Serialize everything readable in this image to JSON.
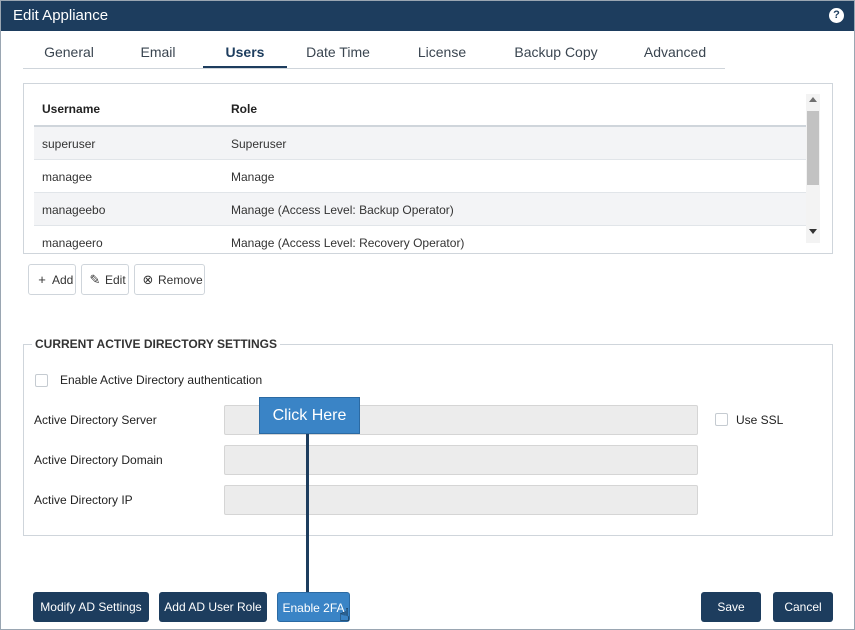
{
  "window": {
    "title": "Edit Appliance",
    "help_icon": "?"
  },
  "tabs": [
    "General",
    "Email",
    "Users",
    "Date Time",
    "License",
    "Backup Copy",
    "Advanced"
  ],
  "active_tab": "Users",
  "users_table": {
    "columns": [
      "Username",
      "Role"
    ],
    "rows": [
      {
        "username": "superuser",
        "role": "Superuser"
      },
      {
        "username": "managee",
        "role": "Manage"
      },
      {
        "username": "manageebo",
        "role": "Manage (Access Level: Backup Operator)"
      },
      {
        "username": "manageero",
        "role": "Manage (Access Level: Recovery Operator)"
      }
    ]
  },
  "table_actions": {
    "add": {
      "label": "Add",
      "icon": "plus-icon",
      "glyph": "+"
    },
    "edit": {
      "label": "Edit",
      "icon": "edit-icon",
      "glyph": "✎"
    },
    "remove": {
      "label": "Remove",
      "icon": "remove-circle-icon",
      "glyph": "⊗"
    }
  },
  "ad_settings": {
    "legend": "CURRENT ACTIVE DIRECTORY SETTINGS",
    "enable_label": "Enable Active Directory authentication",
    "enable_checked": false,
    "server_label": "Active Directory Server",
    "server_value": "",
    "use_ssl_label": "Use SSL",
    "use_ssl_checked": false,
    "domain_label": "Active Directory Domain",
    "domain_value": "",
    "ip_label": "Active Directory IP",
    "ip_value": ""
  },
  "footer": {
    "modify_ad": "Modify AD Settings",
    "add_ad_role": "Add AD User Role",
    "enable_2fa": "Enable 2FA",
    "save": "Save",
    "cancel": "Cancel"
  },
  "callout": {
    "text": "Click Here"
  },
  "colors": {
    "title_bar": "#1d3d5e",
    "primary_button": "#1d3d5e",
    "highlight": "#3a84c6"
  }
}
